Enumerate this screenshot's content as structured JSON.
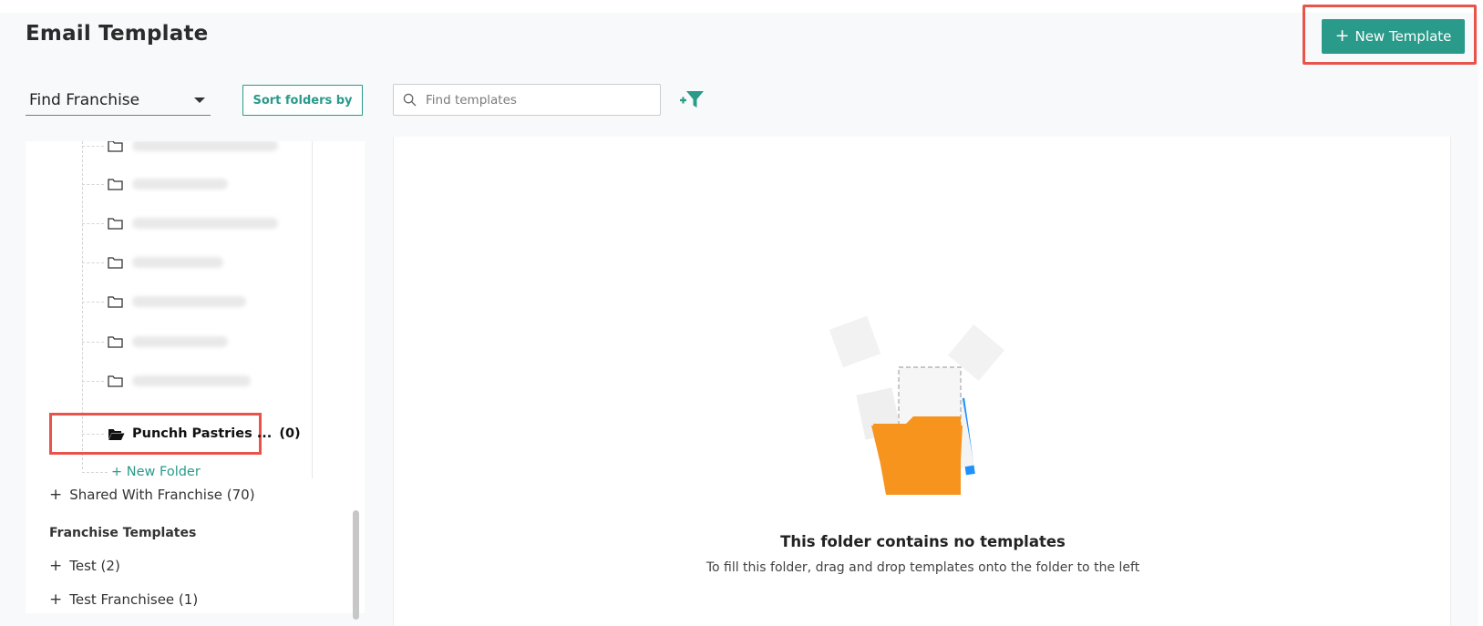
{
  "header": {
    "title": "Email Template",
    "new_template_label": "New Template"
  },
  "toolbar": {
    "franchise_select_value": "Find Franchise",
    "sort_label": "Sort folders by",
    "search_placeholder": "Find templates"
  },
  "tree": {
    "selected_folder": {
      "name": "Punchh Pastries ...",
      "count": "(0)"
    },
    "new_folder_label": "+ New Folder"
  },
  "sidebar": {
    "shared": {
      "toggle": "+",
      "label": "Shared With Franchise (70)"
    },
    "franchise_heading": "Franchise Templates",
    "items": [
      {
        "toggle": "+",
        "label": "Test (2)"
      },
      {
        "toggle": "+",
        "label": "Test Franchisee (1)"
      }
    ]
  },
  "empty_state": {
    "title": "This folder contains no templates",
    "subtitle": "To fill this folder, drag and drop templates onto the folder to the left"
  },
  "colors": {
    "accent": "#2a9a8a",
    "highlight": "#e8534a",
    "folder_orange": "#f7941d",
    "folder_blue": "#1e90ff"
  }
}
